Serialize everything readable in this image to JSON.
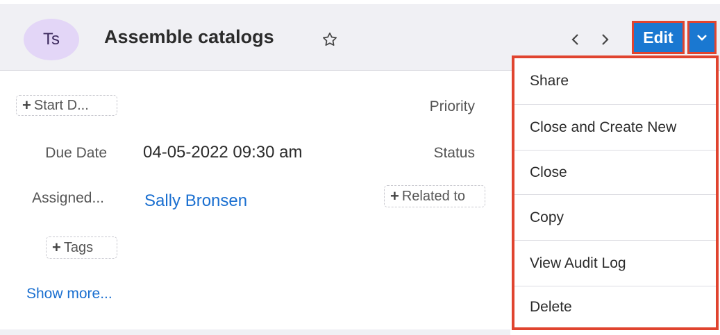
{
  "header": {
    "avatar_initials": "Ts",
    "title": "Assemble catalogs",
    "favorite_icon": "star-outline",
    "prev_icon": "chevron-left",
    "next_icon": "chevron-right",
    "edit_label": "Edit",
    "actions_toggle_icon": "chevron-down"
  },
  "fields": {
    "start_date_pill": "Start D...",
    "priority_label": "Priority",
    "due_date_label": "Due Date",
    "due_date_value": "04-05-2022 09:30 am",
    "status_label": "Status",
    "assigned_label": "Assigned...",
    "assigned_value": "Sally Bronsen",
    "related_pill": "Related to",
    "tags_pill": "Tags",
    "show_more": "Show more..."
  },
  "actions_menu": {
    "items": [
      {
        "label": "Share"
      },
      {
        "label": "Close and Create New"
      },
      {
        "label": "Close"
      },
      {
        "label": "Copy"
      },
      {
        "label": "View Audit Log"
      },
      {
        "label": "Delete"
      }
    ]
  },
  "colors": {
    "accent": "#1a78d1",
    "highlight": "#e0442f",
    "avatar_bg": "#e3d6f7",
    "link": "#1a6fd0"
  }
}
